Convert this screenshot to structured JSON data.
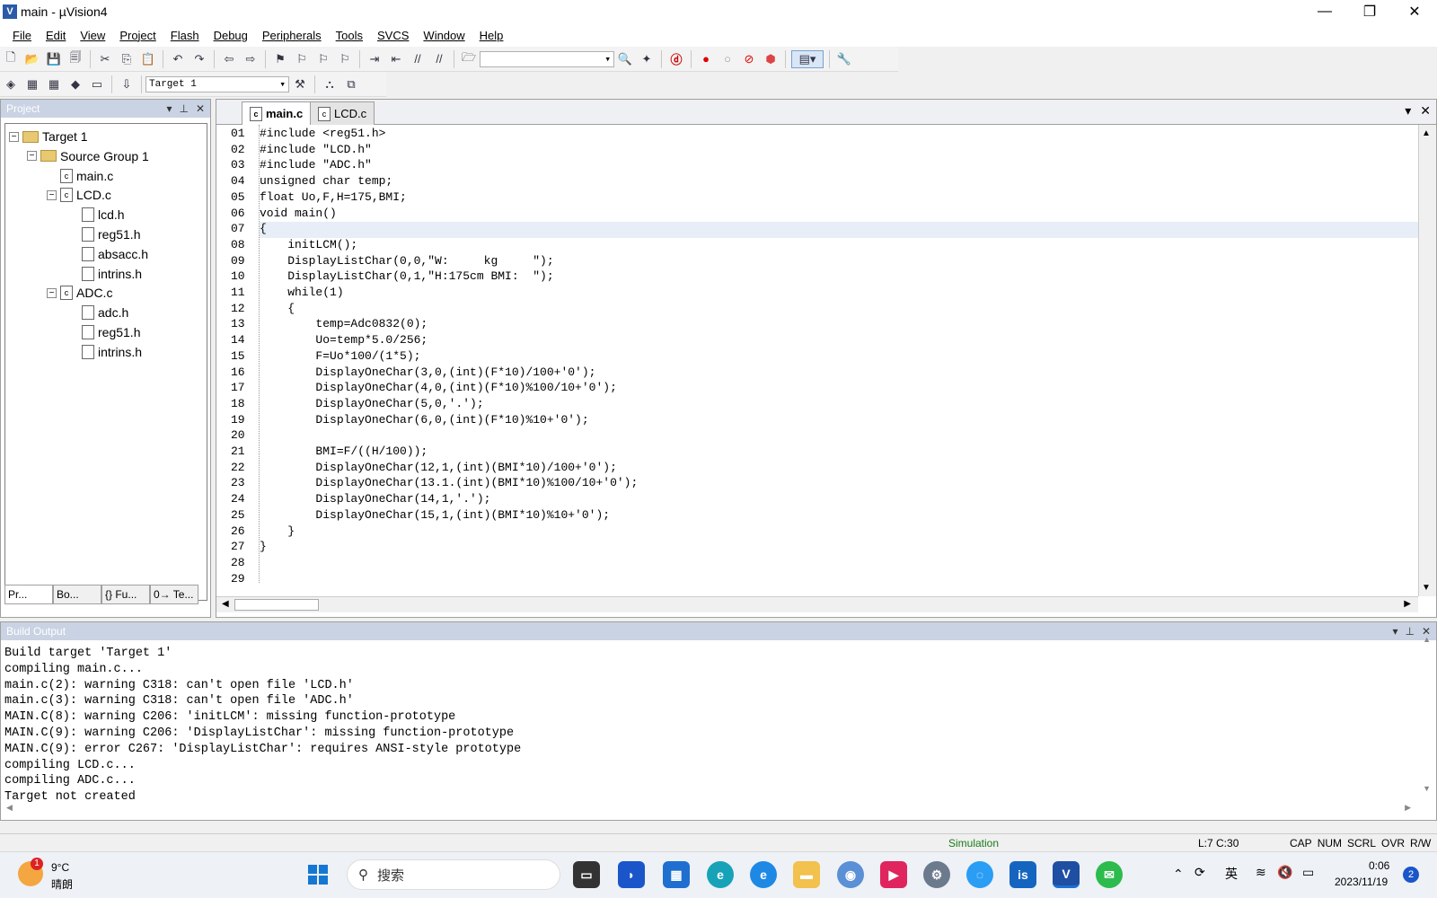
{
  "window": {
    "title": "main  - µVision4",
    "minimize": "—",
    "restore": "❐",
    "close": "✕"
  },
  "menu": [
    "File",
    "Edit",
    "View",
    "Project",
    "Flash",
    "Debug",
    "Peripherals",
    "Tools",
    "SVCS",
    "Window",
    "Help"
  ],
  "toolbar": {
    "target_combo": "Target 1"
  },
  "project_panel": {
    "title": "Project",
    "tree": [
      {
        "label": "Target 1",
        "depth": 0,
        "type": "target",
        "toggle": "−"
      },
      {
        "label": "Source Group 1",
        "depth": 1,
        "type": "folder",
        "toggle": "−"
      },
      {
        "label": "main.c",
        "depth": 2,
        "type": "cfile",
        "toggle": ""
      },
      {
        "label": "LCD.c",
        "depth": 2,
        "type": "cfile",
        "toggle": "−"
      },
      {
        "label": "lcd.h",
        "depth": 3,
        "type": "hfile",
        "toggle": ""
      },
      {
        "label": "reg51.h",
        "depth": 3,
        "type": "hfile",
        "toggle": ""
      },
      {
        "label": "absacc.h",
        "depth": 3,
        "type": "hfile",
        "toggle": ""
      },
      {
        "label": "intrins.h",
        "depth": 3,
        "type": "hfile",
        "toggle": ""
      },
      {
        "label": "ADC.c",
        "depth": 2,
        "type": "cfile",
        "toggle": "−"
      },
      {
        "label": "adc.h",
        "depth": 3,
        "type": "hfile",
        "toggle": ""
      },
      {
        "label": "reg51.h",
        "depth": 3,
        "type": "hfile",
        "toggle": ""
      },
      {
        "label": "intrins.h",
        "depth": 3,
        "type": "hfile",
        "toggle": ""
      }
    ],
    "bottom_tabs": [
      "Pr...",
      "Bo...",
      "{} Fu...",
      "0→ Te..."
    ]
  },
  "editor": {
    "tabs": [
      "main.c",
      "LCD.c"
    ],
    "lines": [
      {
        "n": "01",
        "t": "#include <reg51.h>"
      },
      {
        "n": "02",
        "t": "#include \"LCD.h\""
      },
      {
        "n": "03",
        "t": "#include \"ADC.h\""
      },
      {
        "n": "04",
        "t": "unsigned char temp;"
      },
      {
        "n": "05",
        "t": "float Uo,F,H=175,BMI;"
      },
      {
        "n": "06",
        "t": "void main()"
      },
      {
        "n": "07",
        "t": "{"
      },
      {
        "n": "08",
        "t": "    initLCM();"
      },
      {
        "n": "09",
        "t": "    DisplayListChar(0,0,\"W:     kg     \");"
      },
      {
        "n": "10",
        "t": "    DisplayListChar(0,1,\"H:175cm BMI:  \");"
      },
      {
        "n": "11",
        "t": "    while(1)"
      },
      {
        "n": "12",
        "t": "    {"
      },
      {
        "n": "13",
        "t": "        temp=Adc0832(0);"
      },
      {
        "n": "14",
        "t": "        Uo=temp*5.0/256;"
      },
      {
        "n": "15",
        "t": "        F=Uo*100/(1*5);"
      },
      {
        "n": "16",
        "t": "        DisplayOneChar(3,0,(int)(F*10)/100+'0');"
      },
      {
        "n": "17",
        "t": "        DisplayOneChar(4,0,(int)(F*10)%100/10+'0');"
      },
      {
        "n": "18",
        "t": "        DisplayOneChar(5,0,'.');"
      },
      {
        "n": "19",
        "t": "        DisplayOneChar(6,0,(int)(F*10)%10+'0');"
      },
      {
        "n": "20",
        "t": ""
      },
      {
        "n": "21",
        "t": "        BMI=F/((H/100));"
      },
      {
        "n": "22",
        "t": "        DisplayOneChar(12,1,(int)(BMI*10)/100+'0');"
      },
      {
        "n": "23",
        "t": "        DisplayOneChar(13.1.(int)(BMI*10)%100/10+'0');"
      },
      {
        "n": "24",
        "t": "        DisplayOneChar(14,1,'.');"
      },
      {
        "n": "25",
        "t": "        DisplayOneChar(15,1,(int)(BMI*10)%10+'0');"
      },
      {
        "n": "26",
        "t": "    }"
      },
      {
        "n": "27",
        "t": "}"
      },
      {
        "n": "28",
        "t": ""
      },
      {
        "n": "29",
        "t": ""
      }
    ],
    "highlighted_line": "07"
  },
  "build_output": {
    "title": "Build Output",
    "text": "Build target 'Target 1'\ncompiling main.c...\nmain.c(2): warning C318: can't open file 'LCD.h'\nmain.c(3): warning C318: can't open file 'ADC.h'\nMAIN.C(8): warning C206: 'initLCM': missing function-prototype\nMAIN.C(9): warning C206: 'DisplayListChar': missing function-prototype\nMAIN.C(9): error C267: 'DisplayListChar': requires ANSI-style prototype\ncompiling LCD.c...\ncompiling ADC.c...\nTarget not created"
  },
  "status": {
    "mode": "Simulation",
    "position": "L:7 C:30",
    "indicators": [
      "CAP",
      "NUM",
      "SCRL",
      "OVR",
      "R/W"
    ],
    "mode_color": "#1a7a1a"
  },
  "taskbar": {
    "weather_temp": "9°C",
    "weather_desc": "晴朗",
    "weather_badge": "1",
    "search_placeholder": "搜索",
    "clock_time": "0:06",
    "clock_date": "2023/11/19",
    "ime": "英",
    "notification_count": "2"
  }
}
